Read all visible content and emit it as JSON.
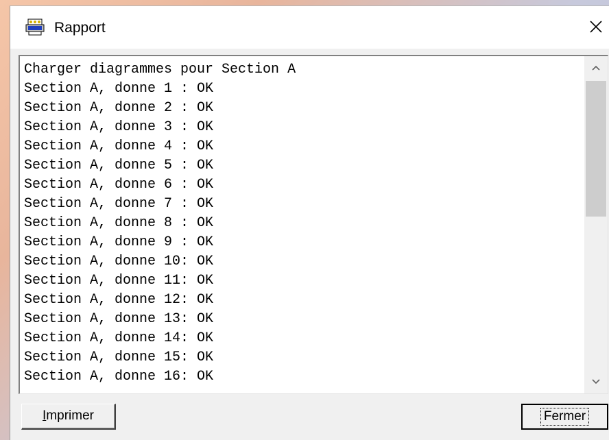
{
  "window": {
    "title": "Rapport",
    "icon": "printer-app-icon",
    "close_icon": "close-icon"
  },
  "report": {
    "lines": [
      "Charger diagrammes pour Section A",
      "Section A, donne 1 : OK",
      "Section A, donne 2 : OK",
      "Section A, donne 3 : OK",
      "Section A, donne 4 : OK",
      "Section A, donne 5 : OK",
      "Section A, donne 6 : OK",
      "Section A, donne 7 : OK",
      "Section A, donne 8 : OK",
      "Section A, donne 9 : OK",
      "Section A, donne 10: OK",
      "Section A, donne 11: OK",
      "Section A, donne 12: OK",
      "Section A, donne 13: OK",
      "Section A, donne 14: OK",
      "Section A, donne 15: OK",
      "Section A, donne 16: OK"
    ]
  },
  "buttons": {
    "print_mnemonic": "I",
    "print_rest": "mprimer",
    "close_label": "Fermer"
  },
  "colors": {
    "window_bg": "#f0f0f0",
    "text": "#000000",
    "scroll_thumb": "#cdcdcd"
  }
}
